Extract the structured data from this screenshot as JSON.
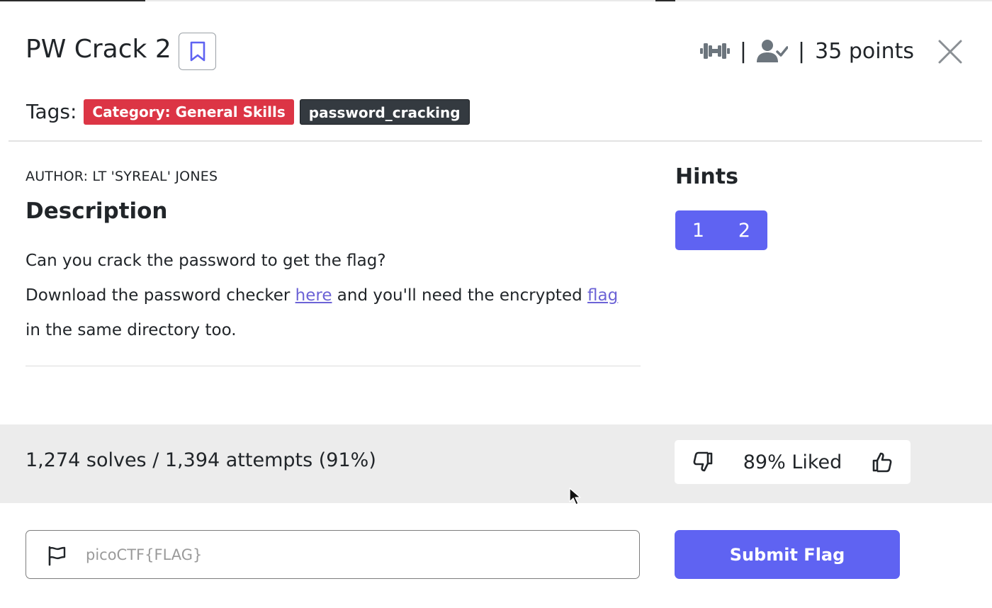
{
  "challenge": {
    "title": "PW Crack 2",
    "points_text": "35 points",
    "separator": "|"
  },
  "tags": {
    "label": "Tags:",
    "category": "Category: General Skills",
    "tag": "password_cracking"
  },
  "author": "AUTHOR: LT 'SYREAL' JONES",
  "description": {
    "heading": "Description",
    "line1": "Can you crack the password to get the flag?",
    "line2_pre": "Download the password checker ",
    "link_here": "here",
    "line2_mid": " and you'll need the encrypted ",
    "link_flag": "flag",
    "line3": "in the same directory too."
  },
  "hints": {
    "heading": "Hints",
    "items": [
      "1",
      "2"
    ]
  },
  "stats": {
    "text": "1,274 solves / 1,394 attempts (91%)",
    "liked_text": "89% Liked"
  },
  "flag_form": {
    "placeholder": "picoCTF{FLAG}",
    "value": "",
    "submit_label": "Submit Flag"
  },
  "icons": {
    "bookmark": "bookmark-icon",
    "difficulty": "dumbbell-icon",
    "solved": "user-check-icon",
    "close": "close-icon",
    "dislike": "thumbs-down-icon",
    "like": "thumbs-up-icon",
    "flag": "flag-icon"
  },
  "colors": {
    "accent": "#5f63f2",
    "category_badge": "#dc3545",
    "tag_badge": "#343a40",
    "link": "#6c63d6",
    "stats_band": "#ececec"
  }
}
